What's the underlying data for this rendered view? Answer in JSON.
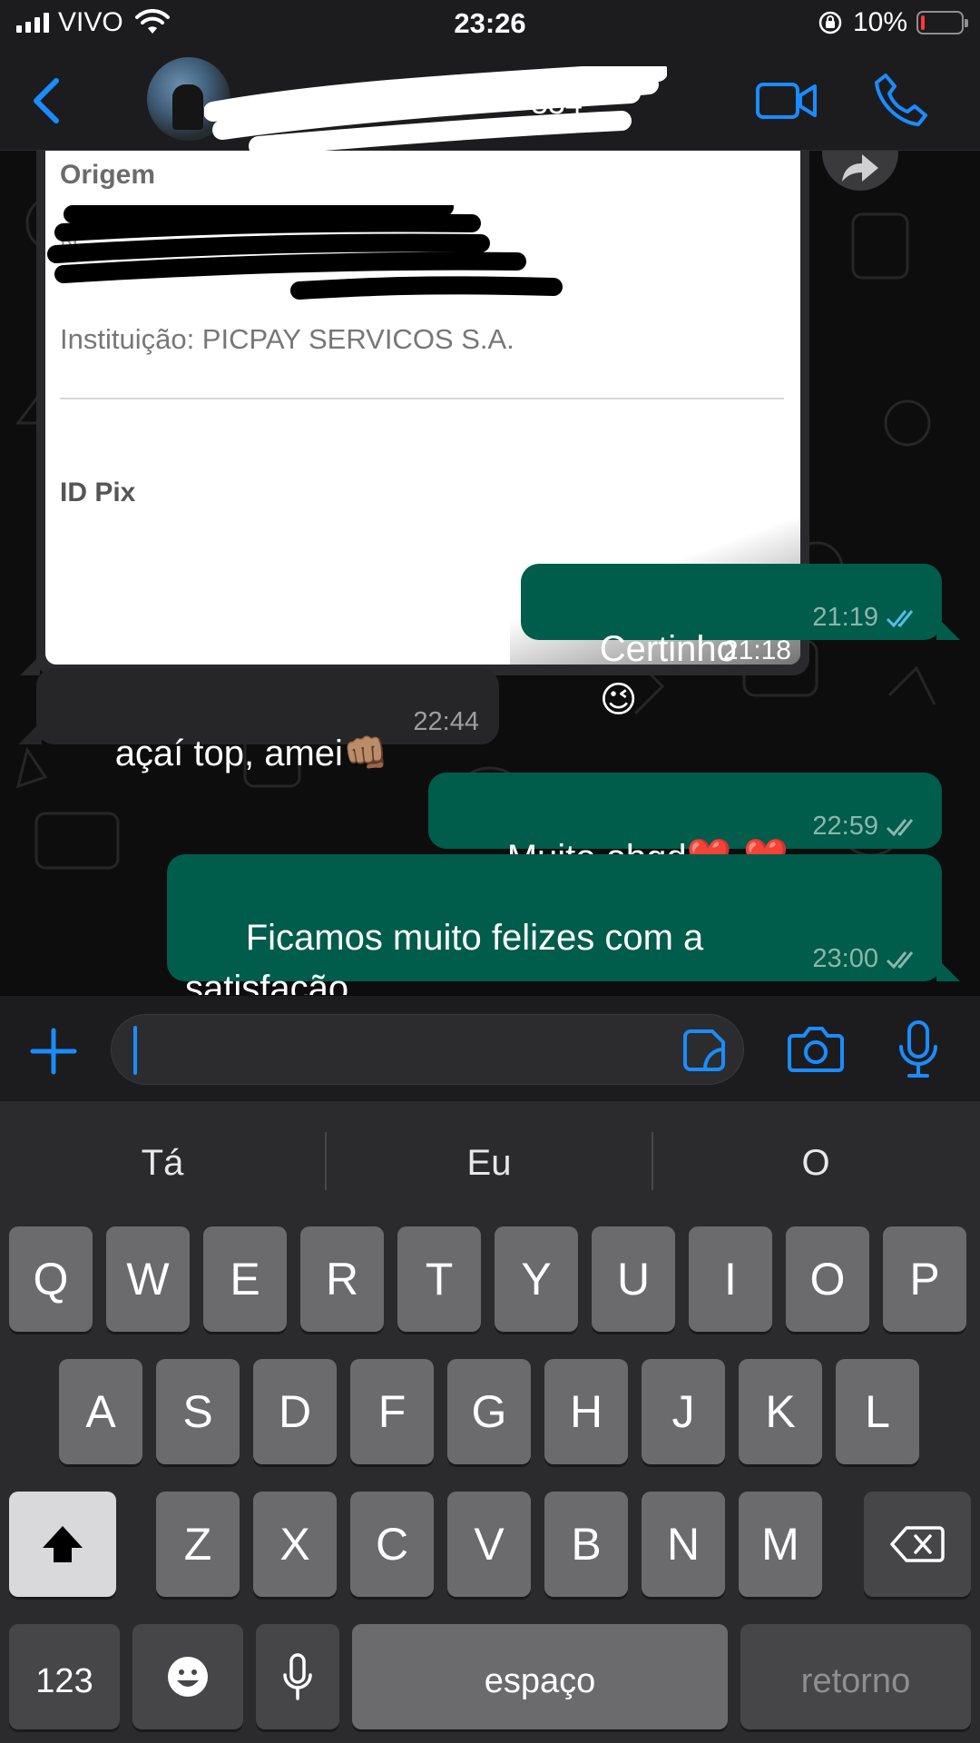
{
  "status_bar": {
    "carrier": "VIVO",
    "time": "23:26",
    "battery_percent": "10%",
    "battery_level": 0.1,
    "battery_color": "#ff3b30"
  },
  "header": {
    "back_icon": "chevron-left-icon",
    "video_icon": "video-camera-icon",
    "call_icon": "phone-icon",
    "accent_color": "#1a8cff"
  },
  "chat": {
    "image_message": {
      "receipt": {
        "origin_heading": "Origem",
        "institution": "Instituição: PICPAY SERVICOS S.A.",
        "pix_heading": "ID Pix"
      },
      "time": "21:18"
    },
    "messages": [
      {
        "direction": "out",
        "text": "Certinho",
        "emoji": "😉",
        "time": "21:19",
        "status": "read"
      },
      {
        "direction": "in",
        "text": "açaí top, amei",
        "emoji": "👊🏽",
        "time": "22:44"
      },
      {
        "direction": "out",
        "text": "Muito obgd",
        "emoji": "❤️ ❤️",
        "time": "22:59",
        "status": "delivered"
      },
      {
        "direction": "out",
        "text": "Ficamos muito felizes com a satisfação\nde vcs",
        "emoji": "❤️ 😻",
        "time": "23:00",
        "status": "delivered"
      }
    ],
    "outgoing_color": "#005c4b",
    "incoming_color": "#262628",
    "read_tick_color": "#53bdeb"
  },
  "input_bar": {
    "plus_icon": "plus-icon",
    "sticker_icon": "sticker-icon",
    "camera_icon": "camera-icon",
    "mic_icon": "microphone-icon"
  },
  "keyboard": {
    "suggestions": [
      "Tá",
      "Eu",
      "O"
    ],
    "row1": [
      "Q",
      "W",
      "E",
      "R",
      "T",
      "Y",
      "U",
      "I",
      "O",
      "P"
    ],
    "row2": [
      "A",
      "S",
      "D",
      "F",
      "G",
      "H",
      "J",
      "K",
      "L"
    ],
    "row3": [
      "Z",
      "X",
      "C",
      "V",
      "B",
      "N",
      "M"
    ],
    "numbers_key": "123",
    "space_key": "espaço",
    "return_key": "retorno",
    "shift_icon": "shift-icon",
    "backspace_icon": "backspace-icon",
    "emoji_icon": "emoji-icon",
    "dictation_icon": "microphone-icon"
  }
}
